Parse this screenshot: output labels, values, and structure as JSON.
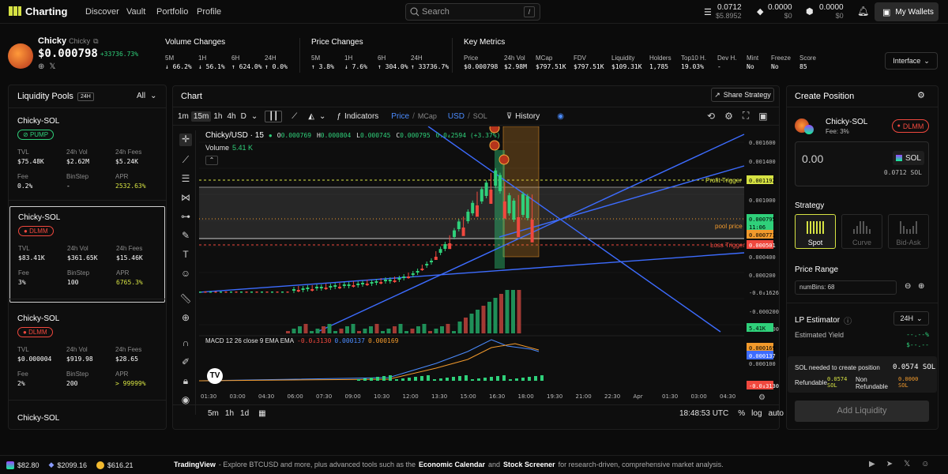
{
  "nav": {
    "brand": "Charting",
    "links": [
      "Discover",
      "Vault",
      "Portfolio",
      "Profile"
    ],
    "search_placeholder": "Search",
    "search_kbd": "/",
    "balances": [
      {
        "v": "0.0712",
        "s": "$5.8952"
      },
      {
        "v": "0.0000",
        "s": "$0"
      },
      {
        "v": "0.0000",
        "s": "$0"
      }
    ],
    "wallet_label": "My Wallets"
  },
  "token": {
    "name": "Chicky",
    "ticker": "Chicky",
    "price": "$0.000798",
    "change": "+33736.73%"
  },
  "volume_changes": {
    "title": "Volume Changes",
    "items": [
      {
        "p": "5M",
        "v": "66.2%",
        "dir": "down"
      },
      {
        "p": "1H",
        "v": "56.1%",
        "dir": "down"
      },
      {
        "p": "6H",
        "v": "624.0%",
        "dir": "up"
      },
      {
        "p": "24H",
        "v": "0.0%",
        "dir": "up"
      }
    ]
  },
  "price_changes": {
    "title": "Price Changes",
    "items": [
      {
        "p": "5M",
        "v": "3.8%",
        "dir": "up"
      },
      {
        "p": "1H",
        "v": "7.6%",
        "dir": "down"
      },
      {
        "p": "6H",
        "v": "304.0%",
        "dir": "up"
      },
      {
        "p": "24H",
        "v": "33736.7%",
        "dir": "up"
      }
    ]
  },
  "key_metrics": {
    "title": "Key Metrics",
    "items": [
      {
        "k": "Price",
        "v": "$0.000798"
      },
      {
        "k": "24h Vol",
        "v": "$2.98M"
      },
      {
        "k": "MCap",
        "v": "$797.51K"
      },
      {
        "k": "FDV",
        "v": "$797.51K"
      },
      {
        "k": "Liquidity",
        "v": "$109.31K"
      },
      {
        "k": "Holders",
        "v": "1,785"
      },
      {
        "k": "Top10 H.",
        "v": "19.03%"
      },
      {
        "k": "Dev H.",
        "v": "-"
      },
      {
        "k": "Mint",
        "v": "No"
      },
      {
        "k": "Freeze",
        "v": "No"
      },
      {
        "k": "Score",
        "v": "85"
      }
    ]
  },
  "interface_label": "Interface",
  "pools": {
    "title": "Liquidity Pools",
    "badge": "24H",
    "filter": "All",
    "items": [
      {
        "name": "Chicky-SOL",
        "tag": "PUMP",
        "tvl": "$75.48K",
        "vol": "$2.62M",
        "fees": "$5.24K",
        "fee": "0.2%",
        "binstep": "-",
        "apr": "2532.63%"
      },
      {
        "name": "Chicky-SOL",
        "tag": "DLMM",
        "tvl": "$83.41K",
        "vol": "$361.65K",
        "fees": "$15.46K",
        "fee": "3%",
        "binstep": "100",
        "apr": "6765.3%"
      },
      {
        "name": "Chicky-SOL",
        "tag": "DLMM",
        "tvl": "$0.000004",
        "vol": "$919.98",
        "fees": "$28.65",
        "fee": "2%",
        "binstep": "200",
        "apr": "> 99999%"
      },
      {
        "name": "Chicky-SOL"
      }
    ],
    "labels": {
      "tvl": "TVL",
      "vol": "24h Vol",
      "fees": "24h Fees",
      "fee": "Fee",
      "binstep": "BinStep",
      "apr": "APR"
    }
  },
  "chart": {
    "title": "Chart",
    "share": "Share Strategy",
    "intervals": [
      "1m",
      "15m",
      "1h",
      "4h",
      "D"
    ],
    "indicators": "Indicators",
    "price": "Price",
    "mcap": "MCap",
    "usd": "USD",
    "sol": "SOL",
    "history": "History",
    "symbol": "Chicky/USD · 15",
    "ohlc": {
      "o": "0.000769",
      "h": "0.000804",
      "l": "0.000745",
      "c": "0.000795",
      "chg": "0.0₄2594 (+3.37%)"
    },
    "volume": "Volume",
    "volume_val": "5.41 K",
    "macd": "MACD 12 26 close 9 EMA EMA",
    "macd_vals": [
      "-0.0₄3130",
      "0.000137",
      "0.000169"
    ],
    "profit_trigger": "Profit Trigger",
    "loss_trigger": "Loss Trigger",
    "pool_price": "pool price",
    "price_axis": [
      "0.001600",
      "0.001400",
      "0.001192",
      "0.001000",
      "0.000795",
      "11:06",
      "0.000771",
      "0.000501",
      "0.000400",
      "0.000200",
      "-0.0₄1626",
      "-0.000200",
      "-0.000400",
      "5.41K",
      "0.000169",
      "0.000137",
      "0.000100",
      "-0.0₄3130"
    ],
    "time_axis": [
      "01:30",
      "03:00",
      "04:30",
      "06:00",
      "07:30",
      "09:00",
      "10:30",
      "12:00",
      "13:30",
      "15:00",
      "16:30",
      "18:00",
      "19:30",
      "21:00",
      "22:30",
      "Apr",
      "01:30",
      "03:00",
      "04:30"
    ],
    "ranges": [
      "5m",
      "1h",
      "1d"
    ],
    "clock": "18:48:53 UTC",
    "pct": "%",
    "log": "log",
    "auto": "auto"
  },
  "chart_data": {
    "type": "candlestick",
    "title": "Chicky/USD · 15",
    "x": [
      "01:30",
      "03:00",
      "04:30",
      "06:00",
      "07:30",
      "09:00",
      "10:30",
      "12:00",
      "13:30",
      "15:00",
      "16:30",
      "18:00"
    ],
    "close": [
      0.0,
      1e-05,
      2e-05,
      3e-05,
      4e-05,
      5e-05,
      6e-05,
      8e-05,
      0.00025,
      0.0004,
      0.0012,
      0.000795
    ],
    "ylim": [
      -0.0004,
      0.0017
    ]
  },
  "position": {
    "title": "Create Position",
    "pair": "Chicky-SOL",
    "fee": "Fee: 3%",
    "tag": "DLMM",
    "amount": "0.00",
    "token": "SOL",
    "balance": "0.0712 SOL",
    "strategy": "Strategy",
    "strategies": [
      "Spot",
      "Curve",
      "Bid-Ask"
    ],
    "range": "Price Range",
    "numbins": "numBins: 68",
    "lp": "LP Estimator",
    "period": "24H",
    "yield": "Estimated Yield",
    "yield_v1": "--.--%",
    "yield_v2": "$--.--",
    "need": "SOL needed to create position",
    "need_v": "0.0574 SOL",
    "refundable": "Refundable",
    "ref_v": "0.0574 SOL",
    "nonref": "Non Refundable",
    "nonref_v": "0.0000 SOL",
    "add": "Add Liquidity"
  },
  "footer": {
    "t1": "$82.80",
    "t2": "$2099.16",
    "t3": "$616.21",
    "tv": "TradingView",
    "msg": "- Explore BTCUSD and more, plus advanced tools such as the",
    "l1": "Economic Calendar",
    "and": "and",
    "l2": "Stock Screener",
    "tail": "for research-driven, comprehensive market analysis."
  }
}
